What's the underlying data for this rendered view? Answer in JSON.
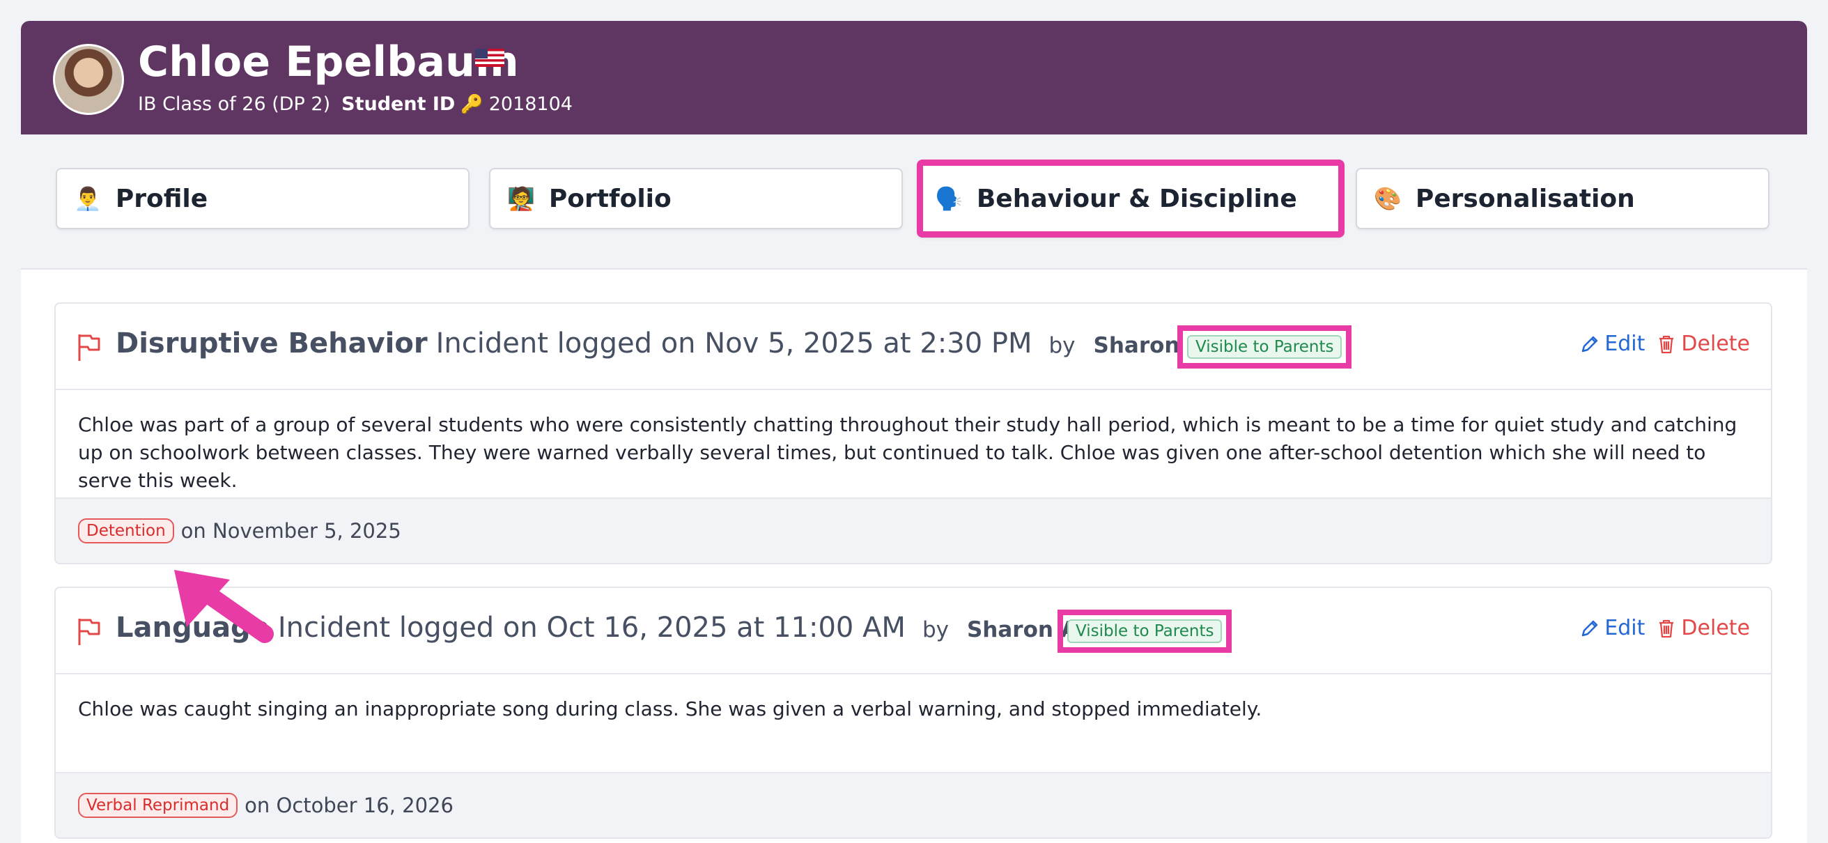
{
  "student": {
    "name": "Chloe Epelbaum",
    "class": "IB Class of 26 (DP 2)",
    "id_label": "Student ID",
    "id_value": "2018104"
  },
  "tabs": [
    {
      "label": "Profile",
      "icon": "profile-icon"
    },
    {
      "label": "Portfolio",
      "icon": "portfolio-icon"
    },
    {
      "label": "Behaviour & Discipline",
      "icon": "behaviour-icon",
      "active": true
    },
    {
      "label": "Personalisation",
      "icon": "personalisation-icon"
    }
  ],
  "incidents": [
    {
      "type": "Disruptive Behavior",
      "logged": "Incident logged on Nov 5, 2025 at 2:30 PM",
      "by": "by",
      "author": "Sharon Arese",
      "visibility": "Visible to Parents",
      "edit": "Edit",
      "delete": "Delete",
      "description": "Chloe was part of a group of several students who were consistently chatting throughout their study hall period, which is meant to be a time for quiet study and catching up on schoolwork between classes. They were warned verbally several times, but continued to talk. Chloe was given one after-school detention which she will need to serve this week.",
      "consequence": "Detention",
      "consequence_date": "on November 5, 2025"
    },
    {
      "type": "Language",
      "logged": "Incident logged on Oct 16, 2025 at 11:00 AM",
      "by": "by",
      "author": "Sharon Arese",
      "visibility": "Visible to Parents",
      "edit": "Edit",
      "delete": "Delete",
      "description": "Chloe was caught singing an inappropriate song during class. She was given a verbal warning, and stopped immediately.",
      "consequence": "Verbal Reprimand",
      "consequence_date": "on October 16, 2026"
    }
  ],
  "colors": {
    "header_bg": "#5f3562",
    "highlight": "#e83ba6",
    "edit": "#2467d6",
    "delete": "#e24848"
  }
}
